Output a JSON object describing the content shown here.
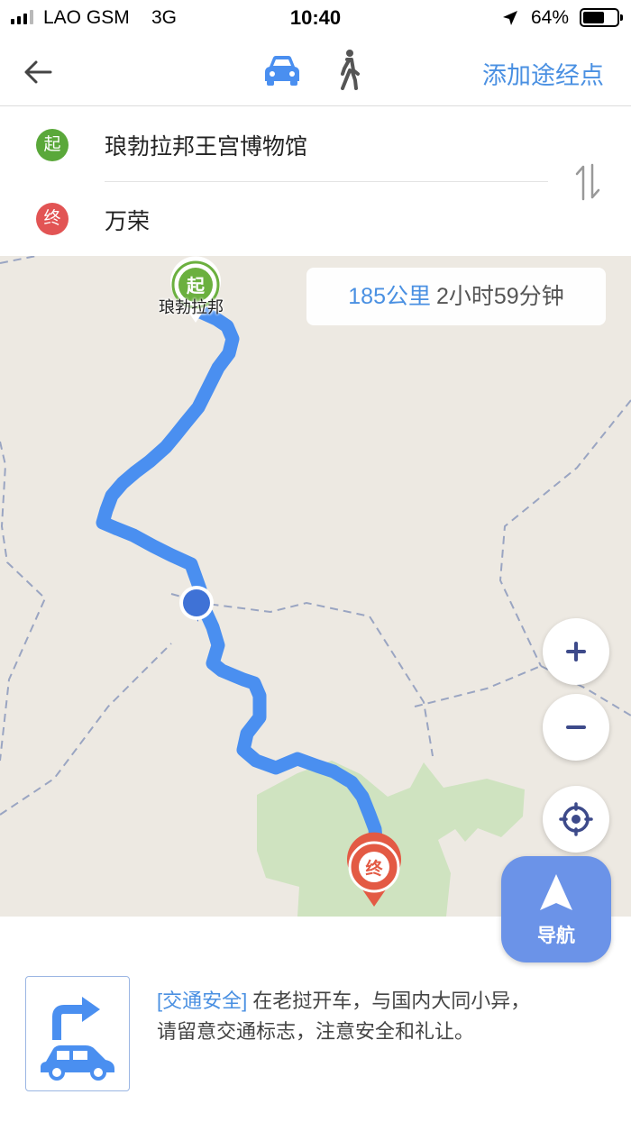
{
  "status_bar": {
    "carrier": "LAO GSM",
    "network": "3G",
    "time": "10:40",
    "battery_percent_label": "64%",
    "battery_level": 0.64
  },
  "nav_bar": {
    "back_icon": "arrow-left-icon",
    "modes": [
      {
        "icon": "car-icon",
        "selected": true
      },
      {
        "icon": "walk-icon",
        "selected": false
      }
    ],
    "add_waypoint_label": "添加途经点"
  },
  "route": {
    "origin_badge": "起",
    "origin": "琅勃拉邦王宫博物馆",
    "destination_badge": "终",
    "destination": "万荣",
    "swap_icon": "swap-vertical-icon"
  },
  "map": {
    "summary_distance": "185公里",
    "summary_duration": "2小时59分钟",
    "start_marker_text": "起",
    "start_marker_label": "琅勃拉邦",
    "end_marker_text": "终",
    "controls": {
      "zoom_in_icon": "plus-icon",
      "zoom_out_icon": "minus-icon",
      "locate_icon": "locate-target-icon"
    },
    "colors": {
      "route": "#4a8ff0",
      "start": "#6bb03f",
      "end": "#e35a44",
      "forest": "#cfe3c0",
      "land": "#ede9e2"
    }
  },
  "navigate_button": {
    "label": "导航",
    "icon": "navigation-arrow-icon"
  },
  "tip": {
    "icon": "turn-right-car-icon",
    "tag": "[交通安全]",
    "line1": "在老挝开车，与国内大同小异，",
    "line2": "请留意交通标志，注意安全和礼让。"
  }
}
